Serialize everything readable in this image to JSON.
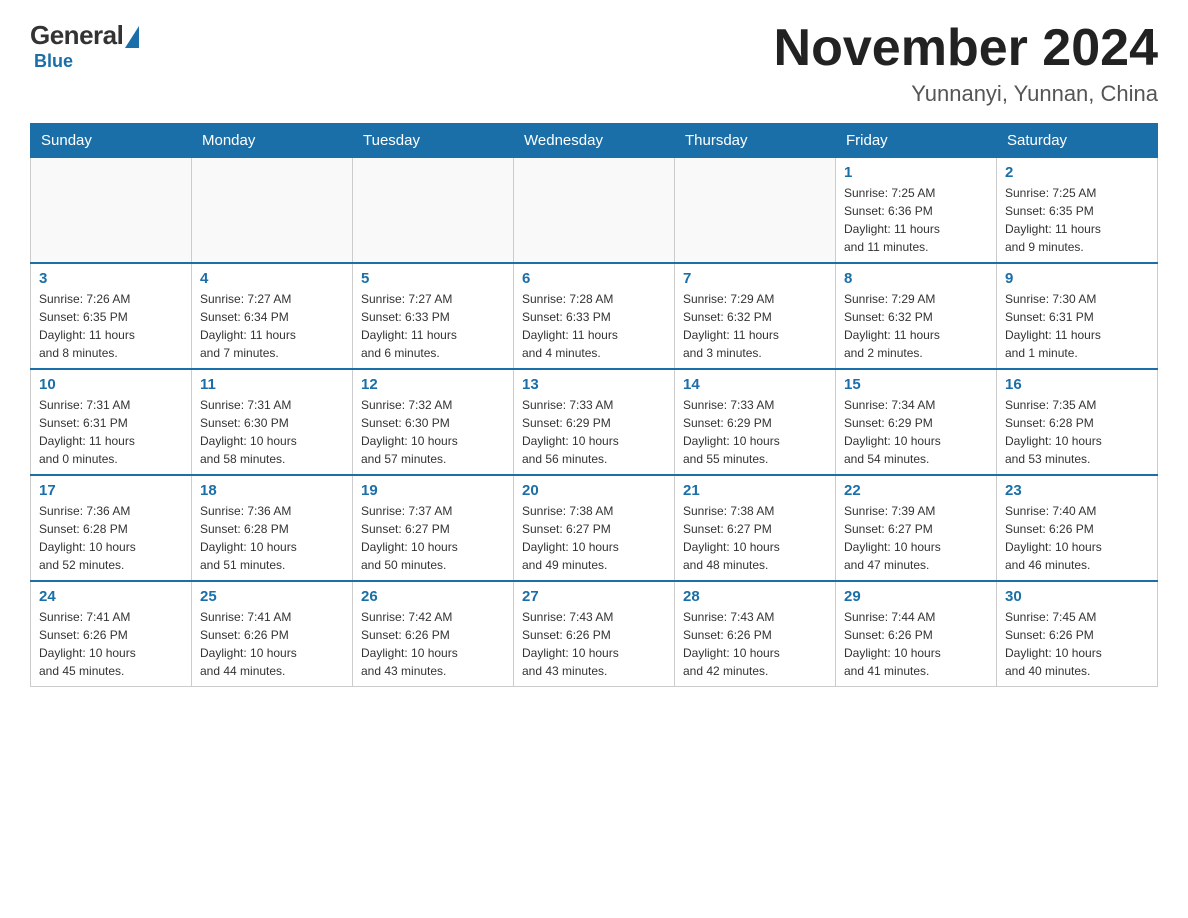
{
  "header": {
    "logo_general": "General",
    "logo_blue": "Blue",
    "month_title": "November 2024",
    "location": "Yunnanyi, Yunnan, China"
  },
  "weekdays": [
    "Sunday",
    "Monday",
    "Tuesday",
    "Wednesday",
    "Thursday",
    "Friday",
    "Saturday"
  ],
  "weeks": [
    [
      {
        "day": "",
        "info": ""
      },
      {
        "day": "",
        "info": ""
      },
      {
        "day": "",
        "info": ""
      },
      {
        "day": "",
        "info": ""
      },
      {
        "day": "",
        "info": ""
      },
      {
        "day": "1",
        "info": "Sunrise: 7:25 AM\nSunset: 6:36 PM\nDaylight: 11 hours\nand 11 minutes."
      },
      {
        "day": "2",
        "info": "Sunrise: 7:25 AM\nSunset: 6:35 PM\nDaylight: 11 hours\nand 9 minutes."
      }
    ],
    [
      {
        "day": "3",
        "info": "Sunrise: 7:26 AM\nSunset: 6:35 PM\nDaylight: 11 hours\nand 8 minutes."
      },
      {
        "day": "4",
        "info": "Sunrise: 7:27 AM\nSunset: 6:34 PM\nDaylight: 11 hours\nand 7 minutes."
      },
      {
        "day": "5",
        "info": "Sunrise: 7:27 AM\nSunset: 6:33 PM\nDaylight: 11 hours\nand 6 minutes."
      },
      {
        "day": "6",
        "info": "Sunrise: 7:28 AM\nSunset: 6:33 PM\nDaylight: 11 hours\nand 4 minutes."
      },
      {
        "day": "7",
        "info": "Sunrise: 7:29 AM\nSunset: 6:32 PM\nDaylight: 11 hours\nand 3 minutes."
      },
      {
        "day": "8",
        "info": "Sunrise: 7:29 AM\nSunset: 6:32 PM\nDaylight: 11 hours\nand 2 minutes."
      },
      {
        "day": "9",
        "info": "Sunrise: 7:30 AM\nSunset: 6:31 PM\nDaylight: 11 hours\nand 1 minute."
      }
    ],
    [
      {
        "day": "10",
        "info": "Sunrise: 7:31 AM\nSunset: 6:31 PM\nDaylight: 11 hours\nand 0 minutes."
      },
      {
        "day": "11",
        "info": "Sunrise: 7:31 AM\nSunset: 6:30 PM\nDaylight: 10 hours\nand 58 minutes."
      },
      {
        "day": "12",
        "info": "Sunrise: 7:32 AM\nSunset: 6:30 PM\nDaylight: 10 hours\nand 57 minutes."
      },
      {
        "day": "13",
        "info": "Sunrise: 7:33 AM\nSunset: 6:29 PM\nDaylight: 10 hours\nand 56 minutes."
      },
      {
        "day": "14",
        "info": "Sunrise: 7:33 AM\nSunset: 6:29 PM\nDaylight: 10 hours\nand 55 minutes."
      },
      {
        "day": "15",
        "info": "Sunrise: 7:34 AM\nSunset: 6:29 PM\nDaylight: 10 hours\nand 54 minutes."
      },
      {
        "day": "16",
        "info": "Sunrise: 7:35 AM\nSunset: 6:28 PM\nDaylight: 10 hours\nand 53 minutes."
      }
    ],
    [
      {
        "day": "17",
        "info": "Sunrise: 7:36 AM\nSunset: 6:28 PM\nDaylight: 10 hours\nand 52 minutes."
      },
      {
        "day": "18",
        "info": "Sunrise: 7:36 AM\nSunset: 6:28 PM\nDaylight: 10 hours\nand 51 minutes."
      },
      {
        "day": "19",
        "info": "Sunrise: 7:37 AM\nSunset: 6:27 PM\nDaylight: 10 hours\nand 50 minutes."
      },
      {
        "day": "20",
        "info": "Sunrise: 7:38 AM\nSunset: 6:27 PM\nDaylight: 10 hours\nand 49 minutes."
      },
      {
        "day": "21",
        "info": "Sunrise: 7:38 AM\nSunset: 6:27 PM\nDaylight: 10 hours\nand 48 minutes."
      },
      {
        "day": "22",
        "info": "Sunrise: 7:39 AM\nSunset: 6:27 PM\nDaylight: 10 hours\nand 47 minutes."
      },
      {
        "day": "23",
        "info": "Sunrise: 7:40 AM\nSunset: 6:26 PM\nDaylight: 10 hours\nand 46 minutes."
      }
    ],
    [
      {
        "day": "24",
        "info": "Sunrise: 7:41 AM\nSunset: 6:26 PM\nDaylight: 10 hours\nand 45 minutes."
      },
      {
        "day": "25",
        "info": "Sunrise: 7:41 AM\nSunset: 6:26 PM\nDaylight: 10 hours\nand 44 minutes."
      },
      {
        "day": "26",
        "info": "Sunrise: 7:42 AM\nSunset: 6:26 PM\nDaylight: 10 hours\nand 43 minutes."
      },
      {
        "day": "27",
        "info": "Sunrise: 7:43 AM\nSunset: 6:26 PM\nDaylight: 10 hours\nand 43 minutes."
      },
      {
        "day": "28",
        "info": "Sunrise: 7:43 AM\nSunset: 6:26 PM\nDaylight: 10 hours\nand 42 minutes."
      },
      {
        "day": "29",
        "info": "Sunrise: 7:44 AM\nSunset: 6:26 PM\nDaylight: 10 hours\nand 41 minutes."
      },
      {
        "day": "30",
        "info": "Sunrise: 7:45 AM\nSunset: 6:26 PM\nDaylight: 10 hours\nand 40 minutes."
      }
    ]
  ]
}
